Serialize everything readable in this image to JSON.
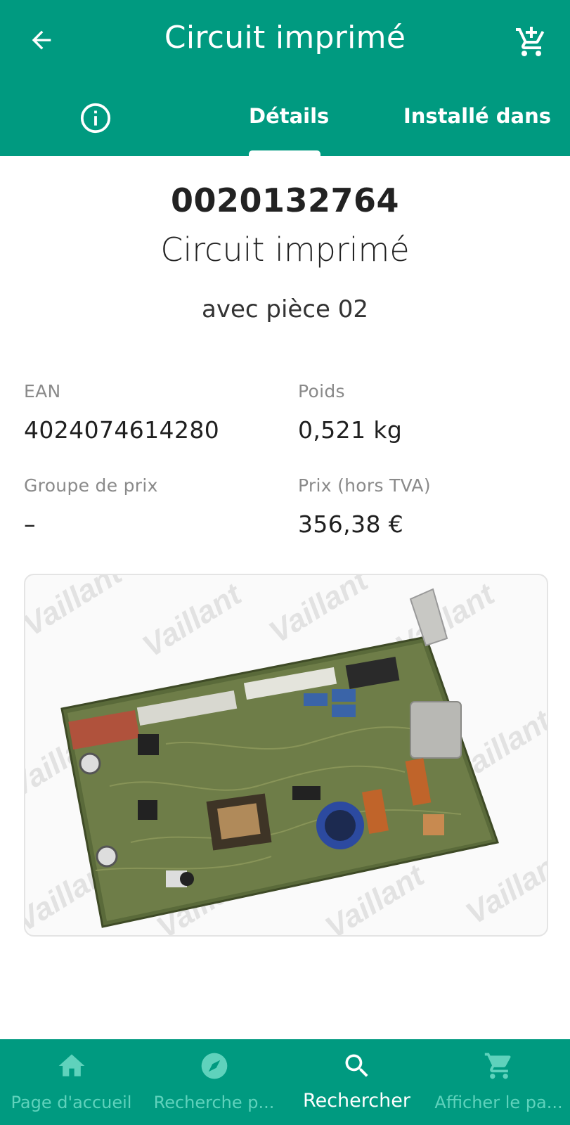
{
  "header": {
    "title": "Circuit imprimé",
    "back_icon": "arrow-left-icon",
    "cart_icon": "add-to-cart-icon"
  },
  "tabs": [
    {
      "icon": "info-icon"
    },
    {
      "label": "Détails",
      "active": true
    },
    {
      "label": "Installé dans"
    }
  ],
  "product": {
    "reference": "0020132764",
    "name": "Circuit imprimé",
    "subtitle": "avec pièce 02"
  },
  "details": {
    "ean_label": "EAN",
    "ean_value": "4024074614280",
    "poids_label": "Poids",
    "poids_value": "0,521 kg",
    "groupe_label": "Groupe de prix",
    "groupe_value": "–",
    "prix_label": "Prix (hors TVA)",
    "prix_value": "356,38 €"
  },
  "image": {
    "watermark": "Vaillant"
  },
  "bottom_nav": [
    {
      "label": "Page d'accueil",
      "icon": "home-icon"
    },
    {
      "label": "Recherche p...",
      "icon": "compass-icon"
    },
    {
      "label": "Rechercher",
      "icon": "search-icon",
      "active": true
    },
    {
      "label": "Afficher le pa...",
      "icon": "cart-icon"
    }
  ],
  "colors": {
    "primary": "#009a80",
    "nav_inactive": "#5fd2bc"
  }
}
